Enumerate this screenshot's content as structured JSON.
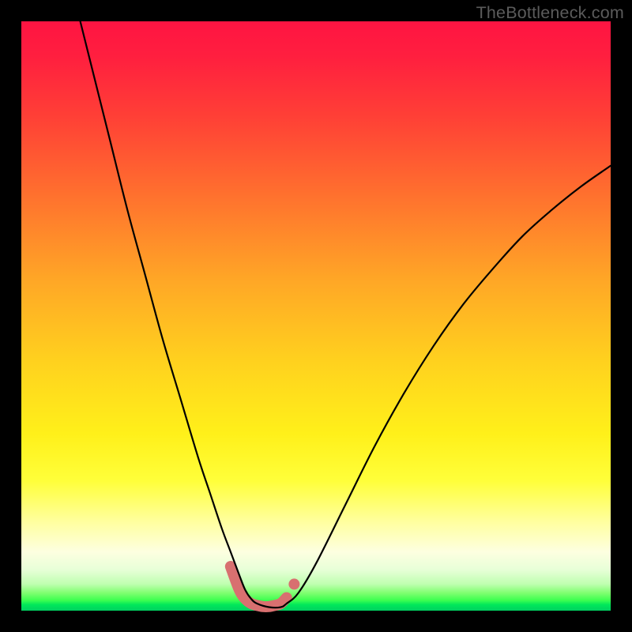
{
  "watermark": "TheBottleneck.com",
  "chart_data": {
    "type": "line",
    "title": "",
    "xlabel": "",
    "ylabel": "",
    "xlim": [
      0,
      100
    ],
    "ylim": [
      0,
      100
    ],
    "grid": false,
    "legend": false,
    "series": [
      {
        "name": "bottleneck-curve",
        "stroke": "#000000",
        "stroke_width": 2.2,
        "x": [
          10,
          12,
          15,
          18,
          21,
          24,
          27,
          30,
          32,
          34,
          35.5,
          37,
          38,
          39,
          40,
          42,
          44,
          45,
          47,
          50,
          55,
          60,
          65,
          70,
          75,
          80,
          85,
          90,
          95,
          100
        ],
        "y": [
          100,
          92,
          80,
          68,
          57,
          46,
          36,
          26,
          20,
          14,
          10,
          6,
          3.5,
          2,
          1.2,
          0.6,
          0.6,
          1.2,
          3,
          8,
          18,
          28,
          37,
          45,
          52,
          58,
          63.5,
          68,
          72,
          75.5
        ]
      },
      {
        "name": "highlight-band",
        "stroke": "#d87070",
        "stroke_width": 14,
        "x": [
          35.5,
          37,
          38,
          39,
          40,
          41,
          42,
          43,
          44,
          45
        ],
        "y": [
          7.5,
          3.5,
          2,
          1.2,
          0.9,
          0.7,
          0.7,
          0.9,
          1.2,
          2.2
        ]
      }
    ],
    "markers": [
      {
        "name": "highlight-dot-right",
        "x": 46.3,
        "y": 4.5,
        "r": 7,
        "fill": "#d87070"
      }
    ],
    "gradient_stops": [
      {
        "pos": 0,
        "color": "#ff1442"
      },
      {
        "pos": 0.45,
        "color": "#ffa726"
      },
      {
        "pos": 0.75,
        "color": "#ffff3a"
      },
      {
        "pos": 0.93,
        "color": "#e8ffd8"
      },
      {
        "pos": 1.0,
        "color": "#00d060"
      }
    ]
  }
}
